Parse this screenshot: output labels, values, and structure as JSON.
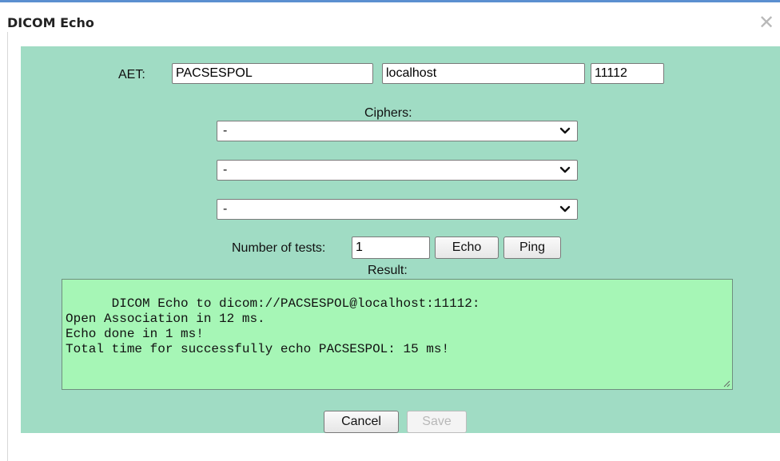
{
  "dialog": {
    "title": "DICOM Echo",
    "close_icon": "close-icon",
    "close_glyph": "✕"
  },
  "connection": {
    "aet_label": "AET:",
    "aet_value": "PACSESPOL",
    "host_value": "localhost",
    "port_value": "11112"
  },
  "ciphers": {
    "label": "Ciphers:",
    "selects": [
      {
        "selected": "-"
      },
      {
        "selected": "-"
      },
      {
        "selected": "-"
      }
    ]
  },
  "tests": {
    "label": "Number of tests:",
    "count_value": "1",
    "echo_label": "Echo",
    "ping_label": "Ping"
  },
  "result": {
    "label": "Result:",
    "text": "DICOM Echo to dicom://PACSESPOL@localhost:11112:\nOpen Association in 12 ms.\nEcho done in 1 ms!\nTotal time for successfully echo PACSESPOL: 15 ms!"
  },
  "footer": {
    "cancel_label": "Cancel",
    "save_label": "Save"
  },
  "colors": {
    "panel_bg": "#a0dcc4",
    "result_bg": "#a6f6b6",
    "titlebar_accent": "#5b8fd0"
  }
}
